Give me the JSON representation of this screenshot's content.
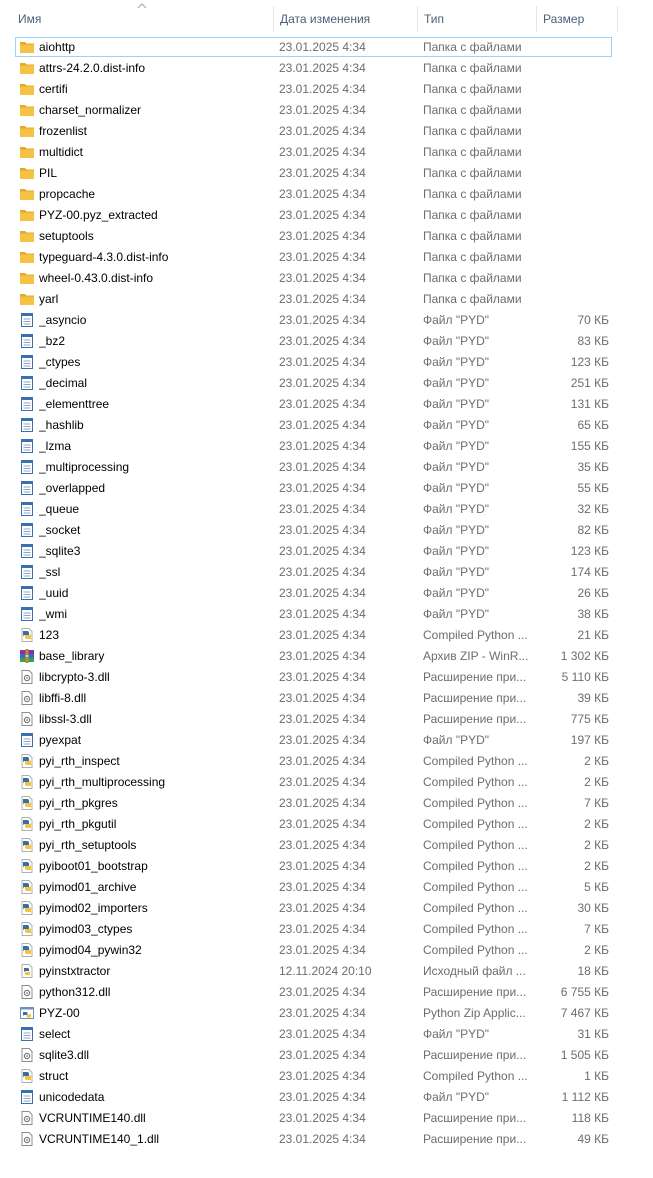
{
  "columns": {
    "name": "Имя",
    "date": "Дата изменения",
    "type": "Тип",
    "size": "Размер"
  },
  "sort": {
    "column": "name",
    "direction": "ascending",
    "icon": "chevron-up-icon"
  },
  "icon_colors": {
    "folder": "#f6c243",
    "folder_dark": "#e2a82a",
    "file_border": "#3a6fb0",
    "python_blue": "#356fa5",
    "python_yellow": "#f4c43a",
    "selection_border": "#99d1ff"
  },
  "files": [
    {
      "name": "aiohttp",
      "date": "23.01.2025 4:34",
      "type": "Папка с файлами",
      "size": "",
      "icon": "folder-icon",
      "selected": true
    },
    {
      "name": "attrs-24.2.0.dist-info",
      "date": "23.01.2025 4:34",
      "type": "Папка с файлами",
      "size": "",
      "icon": "folder-icon"
    },
    {
      "name": "certifi",
      "date": "23.01.2025 4:34",
      "type": "Папка с файлами",
      "size": "",
      "icon": "folder-icon"
    },
    {
      "name": "charset_normalizer",
      "date": "23.01.2025 4:34",
      "type": "Папка с файлами",
      "size": "",
      "icon": "folder-icon"
    },
    {
      "name": "frozenlist",
      "date": "23.01.2025 4:34",
      "type": "Папка с файлами",
      "size": "",
      "icon": "folder-icon"
    },
    {
      "name": "multidict",
      "date": "23.01.2025 4:34",
      "type": "Папка с файлами",
      "size": "",
      "icon": "folder-icon"
    },
    {
      "name": "PIL",
      "date": "23.01.2025 4:34",
      "type": "Папка с файлами",
      "size": "",
      "icon": "folder-icon"
    },
    {
      "name": "propcache",
      "date": "23.01.2025 4:34",
      "type": "Папка с файлами",
      "size": "",
      "icon": "folder-icon"
    },
    {
      "name": "PYZ-00.pyz_extracted",
      "date": "23.01.2025 4:34",
      "type": "Папка с файлами",
      "size": "",
      "icon": "folder-icon"
    },
    {
      "name": "setuptools",
      "date": "23.01.2025 4:34",
      "type": "Папка с файлами",
      "size": "",
      "icon": "folder-icon"
    },
    {
      "name": "typeguard-4.3.0.dist-info",
      "date": "23.01.2025 4:34",
      "type": "Папка с файлами",
      "size": "",
      "icon": "folder-icon"
    },
    {
      "name": "wheel-0.43.0.dist-info",
      "date": "23.01.2025 4:34",
      "type": "Папка с файлами",
      "size": "",
      "icon": "folder-icon"
    },
    {
      "name": "yarl",
      "date": "23.01.2025 4:34",
      "type": "Папка с файлами",
      "size": "",
      "icon": "folder-icon"
    },
    {
      "name": "_asyncio",
      "date": "23.01.2025 4:34",
      "type": "Файл \"PYD\"",
      "size": "70 КБ",
      "icon": "pyd-file-icon"
    },
    {
      "name": "_bz2",
      "date": "23.01.2025 4:34",
      "type": "Файл \"PYD\"",
      "size": "83 КБ",
      "icon": "pyd-file-icon"
    },
    {
      "name": "_ctypes",
      "date": "23.01.2025 4:34",
      "type": "Файл \"PYD\"",
      "size": "123 КБ",
      "icon": "pyd-file-icon"
    },
    {
      "name": "_decimal",
      "date": "23.01.2025 4:34",
      "type": "Файл \"PYD\"",
      "size": "251 КБ",
      "icon": "pyd-file-icon"
    },
    {
      "name": "_elementtree",
      "date": "23.01.2025 4:34",
      "type": "Файл \"PYD\"",
      "size": "131 КБ",
      "icon": "pyd-file-icon"
    },
    {
      "name": "_hashlib",
      "date": "23.01.2025 4:34",
      "type": "Файл \"PYD\"",
      "size": "65 КБ",
      "icon": "pyd-file-icon"
    },
    {
      "name": "_lzma",
      "date": "23.01.2025 4:34",
      "type": "Файл \"PYD\"",
      "size": "155 КБ",
      "icon": "pyd-file-icon"
    },
    {
      "name": "_multiprocessing",
      "date": "23.01.2025 4:34",
      "type": "Файл \"PYD\"",
      "size": "35 КБ",
      "icon": "pyd-file-icon"
    },
    {
      "name": "_overlapped",
      "date": "23.01.2025 4:34",
      "type": "Файл \"PYD\"",
      "size": "55 КБ",
      "icon": "pyd-file-icon"
    },
    {
      "name": "_queue",
      "date": "23.01.2025 4:34",
      "type": "Файл \"PYD\"",
      "size": "32 КБ",
      "icon": "pyd-file-icon"
    },
    {
      "name": "_socket",
      "date": "23.01.2025 4:34",
      "type": "Файл \"PYD\"",
      "size": "82 КБ",
      "icon": "pyd-file-icon"
    },
    {
      "name": "_sqlite3",
      "date": "23.01.2025 4:34",
      "type": "Файл \"PYD\"",
      "size": "123 КБ",
      "icon": "pyd-file-icon"
    },
    {
      "name": "_ssl",
      "date": "23.01.2025 4:34",
      "type": "Файл \"PYD\"",
      "size": "174 КБ",
      "icon": "pyd-file-icon"
    },
    {
      "name": "_uuid",
      "date": "23.01.2025 4:34",
      "type": "Файл \"PYD\"",
      "size": "26 КБ",
      "icon": "pyd-file-icon"
    },
    {
      "name": "_wmi",
      "date": "23.01.2025 4:34",
      "type": "Файл \"PYD\"",
      "size": "38 КБ",
      "icon": "pyd-file-icon"
    },
    {
      "name": "123",
      "date": "23.01.2025 4:34",
      "type": "Compiled Python ...",
      "size": "21 КБ",
      "icon": "python-compiled-icon"
    },
    {
      "name": "base_library",
      "date": "23.01.2025 4:34",
      "type": "Архив ZIP - WinR...",
      "size": "1 302 КБ",
      "icon": "winrar-archive-icon"
    },
    {
      "name": "libcrypto-3.dll",
      "date": "23.01.2025 4:34",
      "type": "Расширение при...",
      "size": "5 110 КБ",
      "icon": "dll-file-icon"
    },
    {
      "name": "libffi-8.dll",
      "date": "23.01.2025 4:34",
      "type": "Расширение при...",
      "size": "39 КБ",
      "icon": "dll-file-icon"
    },
    {
      "name": "libssl-3.dll",
      "date": "23.01.2025 4:34",
      "type": "Расширение при...",
      "size": "775 КБ",
      "icon": "dll-file-icon"
    },
    {
      "name": "pyexpat",
      "date": "23.01.2025 4:34",
      "type": "Файл \"PYD\"",
      "size": "197 КБ",
      "icon": "pyd-file-icon"
    },
    {
      "name": "pyi_rth_inspect",
      "date": "23.01.2025 4:34",
      "type": "Compiled Python ...",
      "size": "2 КБ",
      "icon": "python-compiled-icon"
    },
    {
      "name": "pyi_rth_multiprocessing",
      "date": "23.01.2025 4:34",
      "type": "Compiled Python ...",
      "size": "2 КБ",
      "icon": "python-compiled-icon"
    },
    {
      "name": "pyi_rth_pkgres",
      "date": "23.01.2025 4:34",
      "type": "Compiled Python ...",
      "size": "7 КБ",
      "icon": "python-compiled-icon"
    },
    {
      "name": "pyi_rth_pkgutil",
      "date": "23.01.2025 4:34",
      "type": "Compiled Python ...",
      "size": "2 КБ",
      "icon": "python-compiled-icon"
    },
    {
      "name": "pyi_rth_setuptools",
      "date": "23.01.2025 4:34",
      "type": "Compiled Python ...",
      "size": "2 КБ",
      "icon": "python-compiled-icon"
    },
    {
      "name": "pyiboot01_bootstrap",
      "date": "23.01.2025 4:34",
      "type": "Compiled Python ...",
      "size": "2 КБ",
      "icon": "python-compiled-icon"
    },
    {
      "name": "pyimod01_archive",
      "date": "23.01.2025 4:34",
      "type": "Compiled Python ...",
      "size": "5 КБ",
      "icon": "python-compiled-icon"
    },
    {
      "name": "pyimod02_importers",
      "date": "23.01.2025 4:34",
      "type": "Compiled Python ...",
      "size": "30 КБ",
      "icon": "python-compiled-icon"
    },
    {
      "name": "pyimod03_ctypes",
      "date": "23.01.2025 4:34",
      "type": "Compiled Python ...",
      "size": "7 КБ",
      "icon": "python-compiled-icon"
    },
    {
      "name": "pyimod04_pywin32",
      "date": "23.01.2025 4:34",
      "type": "Compiled Python ...",
      "size": "2 КБ",
      "icon": "python-compiled-icon"
    },
    {
      "name": "pyinstxtractor",
      "date": "12.11.2024 20:10",
      "type": "Исходный файл ...",
      "size": "18 КБ",
      "icon": "python-source-icon"
    },
    {
      "name": "python312.dll",
      "date": "23.01.2025 4:34",
      "type": "Расширение при...",
      "size": "6 755 КБ",
      "icon": "dll-file-icon"
    },
    {
      "name": "PYZ-00",
      "date": "23.01.2025 4:34",
      "type": "Python Zip Applic...",
      "size": "7 467 КБ",
      "icon": "python-zip-icon"
    },
    {
      "name": "select",
      "date": "23.01.2025 4:34",
      "type": "Файл \"PYD\"",
      "size": "31 КБ",
      "icon": "pyd-file-icon"
    },
    {
      "name": "sqlite3.dll",
      "date": "23.01.2025 4:34",
      "type": "Расширение при...",
      "size": "1 505 КБ",
      "icon": "dll-file-icon"
    },
    {
      "name": "struct",
      "date": "23.01.2025 4:34",
      "type": "Compiled Python ...",
      "size": "1 КБ",
      "icon": "python-compiled-icon"
    },
    {
      "name": "unicodedata",
      "date": "23.01.2025 4:34",
      "type": "Файл \"PYD\"",
      "size": "1 112 КБ",
      "icon": "pyd-file-icon"
    },
    {
      "name": "VCRUNTIME140.dll",
      "date": "23.01.2025 4:34",
      "type": "Расширение при...",
      "size": "118 КБ",
      "icon": "dll-file-icon"
    },
    {
      "name": "VCRUNTIME140_1.dll",
      "date": "23.01.2025 4:34",
      "type": "Расширение при...",
      "size": "49 КБ",
      "icon": "dll-file-icon"
    }
  ]
}
